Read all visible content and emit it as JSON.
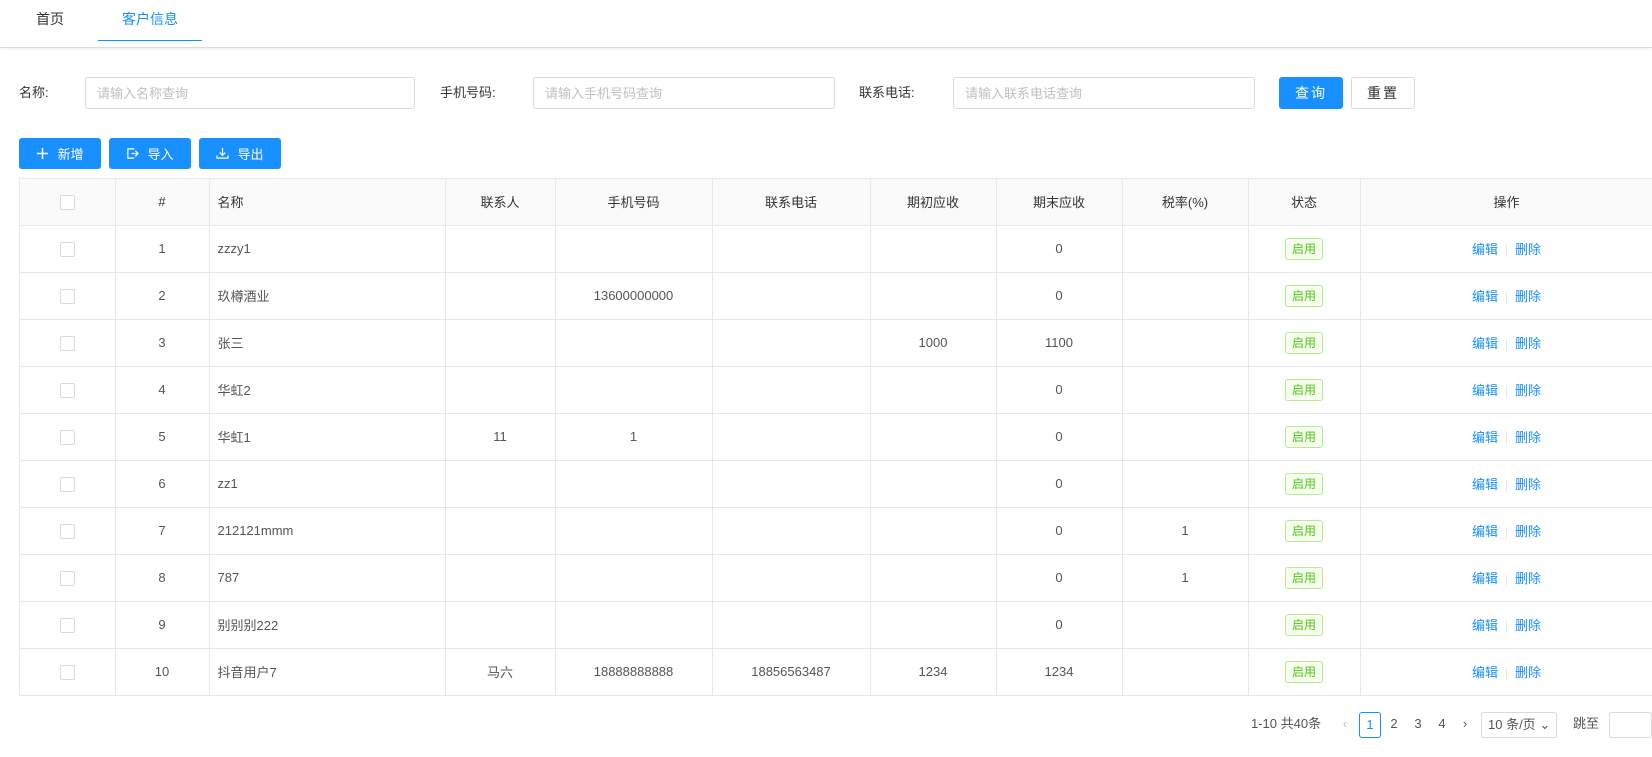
{
  "tabs": [
    {
      "label": "首页"
    },
    {
      "label": "客户信息"
    }
  ],
  "search": {
    "name_label": "名称:",
    "name_placeholder": "请输入名称查询",
    "mobile_label": "手机号码:",
    "mobile_placeholder": "请输入手机号码查询",
    "phone_label": "联系电话:",
    "phone_placeholder": "请输入联系电话查询",
    "query_label": "查询",
    "reset_label": "重置"
  },
  "toolbar": {
    "add_label": "新增",
    "import_label": "导入",
    "export_label": "导出"
  },
  "table": {
    "headers": [
      "#",
      "名称",
      "联系人",
      "手机号码",
      "联系电话",
      "期初应收",
      "期末应收",
      "税率(%)",
      "状态",
      "操作"
    ],
    "edit_label": "编辑",
    "delete_label": "删除",
    "rows": [
      {
        "idx": "1",
        "name": "zzzy1",
        "contact": "",
        "mobile": "",
        "phone": "",
        "begin": "",
        "end": "0",
        "tax": "",
        "status": "启用"
      },
      {
        "idx": "2",
        "name": "玖樽酒业",
        "contact": "",
        "mobile": "13600000000",
        "phone": "",
        "begin": "",
        "end": "0",
        "tax": "",
        "status": "启用"
      },
      {
        "idx": "3",
        "name": "张三",
        "contact": "",
        "mobile": "",
        "phone": "",
        "begin": "1000",
        "end": "1100",
        "tax": "",
        "status": "启用"
      },
      {
        "idx": "4",
        "name": "华虹2",
        "contact": "",
        "mobile": "",
        "phone": "",
        "begin": "",
        "end": "0",
        "tax": "",
        "status": "启用"
      },
      {
        "idx": "5",
        "name": "华虹1",
        "contact": "11",
        "mobile": "1",
        "phone": "",
        "begin": "",
        "end": "0",
        "tax": "",
        "status": "启用"
      },
      {
        "idx": "6",
        "name": "zz1",
        "contact": "",
        "mobile": "",
        "phone": "",
        "begin": "",
        "end": "0",
        "tax": "",
        "status": "启用"
      },
      {
        "idx": "7",
        "name": "212121mmm",
        "contact": "",
        "mobile": "",
        "phone": "",
        "begin": "",
        "end": "0",
        "tax": "1",
        "status": "启用"
      },
      {
        "idx": "8",
        "name": "787",
        "contact": "",
        "mobile": "",
        "phone": "",
        "begin": "",
        "end": "0",
        "tax": "1",
        "status": "启用"
      },
      {
        "idx": "9",
        "name": "别别别222",
        "contact": "",
        "mobile": "",
        "phone": "",
        "begin": "",
        "end": "0",
        "tax": "",
        "status": "启用"
      },
      {
        "idx": "10",
        "name": "抖音用户7",
        "contact": "马六",
        "mobile": "18888888888",
        "phone": "18856563487",
        "begin": "1234",
        "end": "1234",
        "tax": "",
        "status": "启用"
      }
    ]
  },
  "pagination": {
    "summary": "1-10 共40条",
    "pages": [
      "1",
      "2",
      "3",
      "4"
    ],
    "current": "1",
    "page_size": "10 条/页",
    "jump_label": "跳至"
  },
  "colors": {
    "primary": "#1890ff",
    "status_green": "#52c41a"
  }
}
